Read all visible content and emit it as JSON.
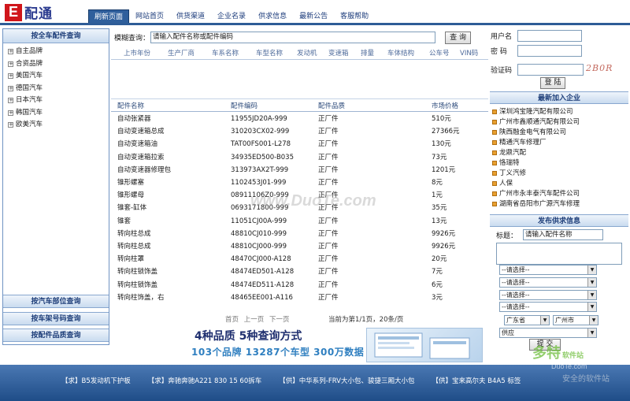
{
  "brand": {
    "logo_letter": "E",
    "logo_text": "配通"
  },
  "nav": [
    {
      "label": "刷新页面",
      "active": true
    },
    {
      "label": "网站首页"
    },
    {
      "label": "供货渠道"
    },
    {
      "label": "企业名录"
    },
    {
      "label": "供求信息"
    },
    {
      "label": "最新公告"
    },
    {
      "label": "客服帮助"
    }
  ],
  "left": {
    "title": "按全车配件查询",
    "tree": [
      "自主品牌",
      "合资品牌",
      "美国汽车",
      "德国汽车",
      "日本汽车",
      "韩国汽车",
      "欧美汽车"
    ],
    "buttons": [
      "按汽车部位查询",
      "按车架号码查询",
      "按配件品质查询"
    ]
  },
  "search": {
    "label": "模糊查询：",
    "value": "请输入配件名称或配件编码",
    "button": "查 询"
  },
  "filters": [
    "上市年份",
    "生产厂商",
    "车系名称",
    "车型名称",
    "发动机",
    "变速箱",
    "排量",
    "车体结构",
    "公车号",
    "VIN码"
  ],
  "table": {
    "headers": [
      "配件名称",
      "配件编码",
      "配件品质",
      "市场价格"
    ],
    "rows": [
      [
        "自动张紧器",
        "11955JD20A-999",
        "正厂件",
        "510元"
      ],
      [
        "自动变速箱总成",
        "310203CX02-999",
        "正厂件",
        "27366元"
      ],
      [
        "自动变速箱油",
        "TAT00FS001-L278",
        "正厂件",
        "130元"
      ],
      [
        "自动变速箱拉索",
        "34935ED500-B035",
        "正厂件",
        "73元"
      ],
      [
        "自动变速器修理包",
        "313973AX2T-999",
        "正厂件",
        "1201元"
      ],
      [
        "锥形螺塞",
        "1102453J01-999",
        "正厂件",
        "8元"
      ],
      [
        "锥形螺母",
        "08911106Z0-999",
        "正厂件",
        "1元"
      ],
      [
        "锥套-缸体",
        "0693171800-999",
        "正厂件",
        "35元"
      ],
      [
        "锥套",
        "11051CJ00A-999",
        "正厂件",
        "13元"
      ],
      [
        "转向柱总成",
        "48810CJ010-999",
        "正厂件",
        "9926元"
      ],
      [
        "转向柱总成",
        "48810CJ000-999",
        "正厂件",
        "9926元"
      ],
      [
        "转向柱罩",
        "48470CJ000-A128",
        "正厂件",
        "20元"
      ],
      [
        "转向柱锁饰盖",
        "48474ED501-A128",
        "正厂件",
        "7元"
      ],
      [
        "转向柱锁饰盖",
        "48474ED511-A128",
        "正厂件",
        "6元"
      ],
      [
        "转向柱饰盖，右",
        "48465EE001-A116",
        "正厂件",
        "3元"
      ]
    ]
  },
  "pager": {
    "links": [
      "首页",
      "上一页",
      "下一页"
    ],
    "status": "当前为第1/1页，20条/页"
  },
  "banner": {
    "line1": "4种品质 5种查询方式",
    "line2": "103个品牌 13287个车型 300万数据"
  },
  "login": {
    "user_label": "用户名",
    "pass_label": "密 码",
    "code_label": "验证码",
    "captcha": "2B0R",
    "button": "登 陆"
  },
  "companies": {
    "title": "最新加入企业",
    "items": [
      "深圳鸿宝隆汽配有限公司",
      "广州市鑫顺通汽配有限公司",
      "陕西融金电气有限公司",
      "精通汽车修理厂",
      "龙鼎汽配",
      "恪瑞特",
      "丁义汽修",
      "人保",
      "广州市永丰泰汽车配件公司",
      "湖南省岳阳市广源汽车修理"
    ]
  },
  "supply": {
    "title": "发布供求信息",
    "title_label": "标题：",
    "title_value": "请输入配件名称",
    "selects": [
      "--请选择--",
      "--请选择--",
      "--请选择--",
      "--请选择--"
    ],
    "province": "广东省",
    "city": "广州市",
    "type": "供应",
    "submit": "提 交"
  },
  "ticker": [
    "【求】B5发动机下护板",
    "【求】奔驰奔驰A221 830 15 60拆车",
    "【供】中华系列-FRV大小包、骏捷三厢大小包",
    "【供】宝来高尔夫 B4A5 标签"
  ],
  "watermarks": {
    "center": "www.DuoTe.com",
    "logo": "多特",
    "logo_sub": "软件站",
    "site": "DuoTe.com",
    "slogan": "安全的软件站"
  }
}
